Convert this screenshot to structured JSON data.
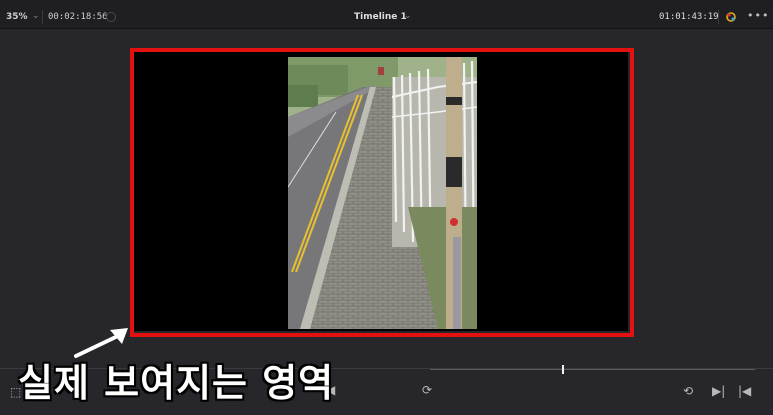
{
  "header": {
    "zoom": "35%",
    "duration": "00:02:18:56",
    "timeline_title": "Timeline 1",
    "timecode": "01:01:43:19",
    "more": "•••"
  },
  "overlay": {
    "caption": "실제 보여지는 영역"
  },
  "colors": {
    "highlight": "#e3110f",
    "viewer_bg": "#000000",
    "panel_bg": "#27272b"
  },
  "icons": {
    "zoom_dropdown": "chevron-down-icon",
    "timeline_dropdown": "chevron-down-icon",
    "fx": "color-fx-icon",
    "more": "more-icon",
    "arrow": "arrow-icon",
    "loop": "loop-icon",
    "next": "next-frame-icon",
    "last": "skip-to-end-icon"
  }
}
